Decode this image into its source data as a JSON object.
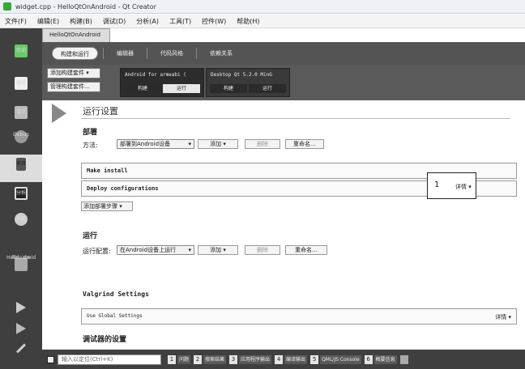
{
  "window": {
    "title": "widget.cpp - HelloQtOnAndroid - Qt Creator"
  },
  "menu": [
    "文件(F)",
    "编辑(E)",
    "构建(B)",
    "调试(D)",
    "分析(A)",
    "工具(T)",
    "控件(W)",
    "帮助(H)"
  ],
  "sidebar": {
    "items": [
      {
        "label": "欢迎"
      },
      {
        "label": "编辑"
      },
      {
        "label": "设计"
      },
      {
        "label": "Debug"
      },
      {
        "label": "项目"
      },
      {
        "label": "分析"
      },
      {
        "label": "帮助"
      }
    ],
    "project_name": "Hello...droid",
    "build_label": "Release"
  },
  "project_tab": "HelloQtOnAndroid",
  "mode_tabs": [
    "构建和运行",
    "编辑器",
    "代码风格",
    "依赖关系"
  ],
  "kit_buttons": [
    "添加构建套件 ▾",
    "管理构建套件…"
  ],
  "kits": [
    {
      "name": "Android for armeabi (",
      "tabs": [
        "构建",
        "运行"
      ],
      "selected": 1
    },
    {
      "name": "Desktop Qt 5.2.0 MinG",
      "tabs": [
        "构建",
        "运行"
      ],
      "selected": -1
    }
  ],
  "run_settings": {
    "title": "运行设置",
    "deploy_section": "部署",
    "method_label": "方法:",
    "method_value": "部署到Android设备",
    "add": "添加",
    "delete": "删除",
    "rename": "重命名…",
    "steps": [
      "Make install",
      "Deploy configurations"
    ],
    "detail_number": "1",
    "detail_label": "详情 ▾",
    "add_deploy_step": "添加部署步骤 ▾",
    "run_section": "运行",
    "run_config_label": "运行配置:",
    "run_config_value": "在Android设备上运行",
    "run_add": "添加",
    "run_delete": "删除",
    "run_rename": "重命名…",
    "valgrind_title": "Valgrind Settings",
    "global_settings": "Use Global Settings",
    "global_detail": "详情 ▾",
    "debugger_title": "调试器的设置"
  },
  "bottom": {
    "locator_placeholder": "输入以定位(Ctrl+K)",
    "panes": [
      {
        "n": "1",
        "label": "问题"
      },
      {
        "n": "2",
        "label": "搜索结果"
      },
      {
        "n": "3",
        "label": "应用程序输出"
      },
      {
        "n": "4",
        "label": "编译输出"
      },
      {
        "n": "5",
        "label": "QML/JS Console"
      },
      {
        "n": "6",
        "label": "概要信息"
      }
    ]
  }
}
